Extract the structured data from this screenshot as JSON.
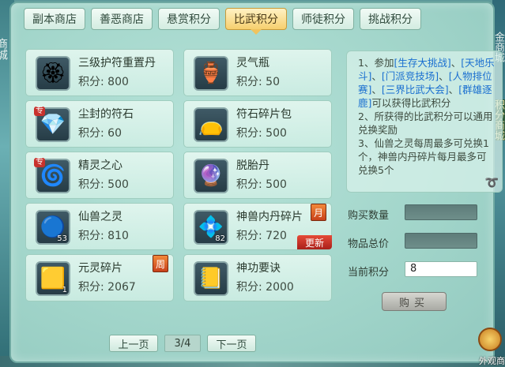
{
  "tabs": [
    {
      "label": "副本商店",
      "active": false
    },
    {
      "label": "善恶商店",
      "active": false
    },
    {
      "label": "悬赏积分",
      "active": false
    },
    {
      "label": "比武积分",
      "active": true
    },
    {
      "label": "师徒积分",
      "active": false
    },
    {
      "label": "挑战积分",
      "active": false
    }
  ],
  "price_prefix": "积分:",
  "items": [
    {
      "name": "三级护符重置丹",
      "price": "积分: 800",
      "icon": "amulet-reset-pill-icon",
      "glyph": "🏵"
    },
    {
      "name": "灵气瓶",
      "price": "积分: 50",
      "icon": "spirit-vase-icon",
      "glyph": "🏺"
    },
    {
      "name": "尘封的符石",
      "price": "积分: 60",
      "icon": "sealed-rune-stone-icon",
      "glyph": "💎",
      "tag": "专"
    },
    {
      "name": "符石碎片包",
      "price": "积分: 500",
      "icon": "rune-fragment-bag-icon",
      "glyph": "👝"
    },
    {
      "name": "精灵之心",
      "price": "积分: 500",
      "icon": "spirit-heart-icon",
      "glyph": "🌀",
      "tag": "专"
    },
    {
      "name": "脱胎丹",
      "price": "积分: 500",
      "icon": "rebirth-pill-icon",
      "glyph": "🔮"
    },
    {
      "name": "仙兽之灵",
      "price": "积分: 810",
      "icon": "beast-spirit-icon",
      "glyph": "🔵",
      "count": "53"
    },
    {
      "name": "神兽内丹碎片",
      "price": "积分: 720",
      "icon": "divine-beast-core-icon",
      "glyph": "💠",
      "count": "82",
      "badge": "月",
      "new_label": "更新"
    },
    {
      "name": "元灵碎片",
      "price": "积分: 2067",
      "icon": "yuanling-fragment-icon",
      "glyph": "🟨",
      "count": "1",
      "badge": "周"
    },
    {
      "name": "神功要诀",
      "price": "积分: 2000",
      "icon": "divine-skill-book-icon",
      "glyph": "📒"
    }
  ],
  "info": {
    "line1_prefix": "1、参加",
    "events": [
      "[生存大挑战]",
      "[天地乐斗]",
      "[门派竞技场]",
      "[人物排位赛]",
      "[三界比武大会]",
      "[群雄逐鹿]"
    ],
    "sep": "、",
    "line1_suffix": "可以获得比武积分",
    "line2": "2、所获得的比武积分可以通用兑换奖励",
    "line3": "3、仙兽之灵每周最多可兑换1个，神兽内丹碎片每月最多可兑换5个"
  },
  "form": {
    "qty_label": "购买数量",
    "qty_value": "",
    "total_label": "物品总价",
    "total_value": "",
    "points_label": "当前积分",
    "points_value": "8"
  },
  "buy_label": "购买",
  "pager": {
    "prev": "上一页",
    "page": "3/4",
    "next": "下一页"
  },
  "side": {
    "left_text": "商城",
    "right_top": "金商城",
    "right_mid": "积分商城",
    "watch": "外观商"
  }
}
